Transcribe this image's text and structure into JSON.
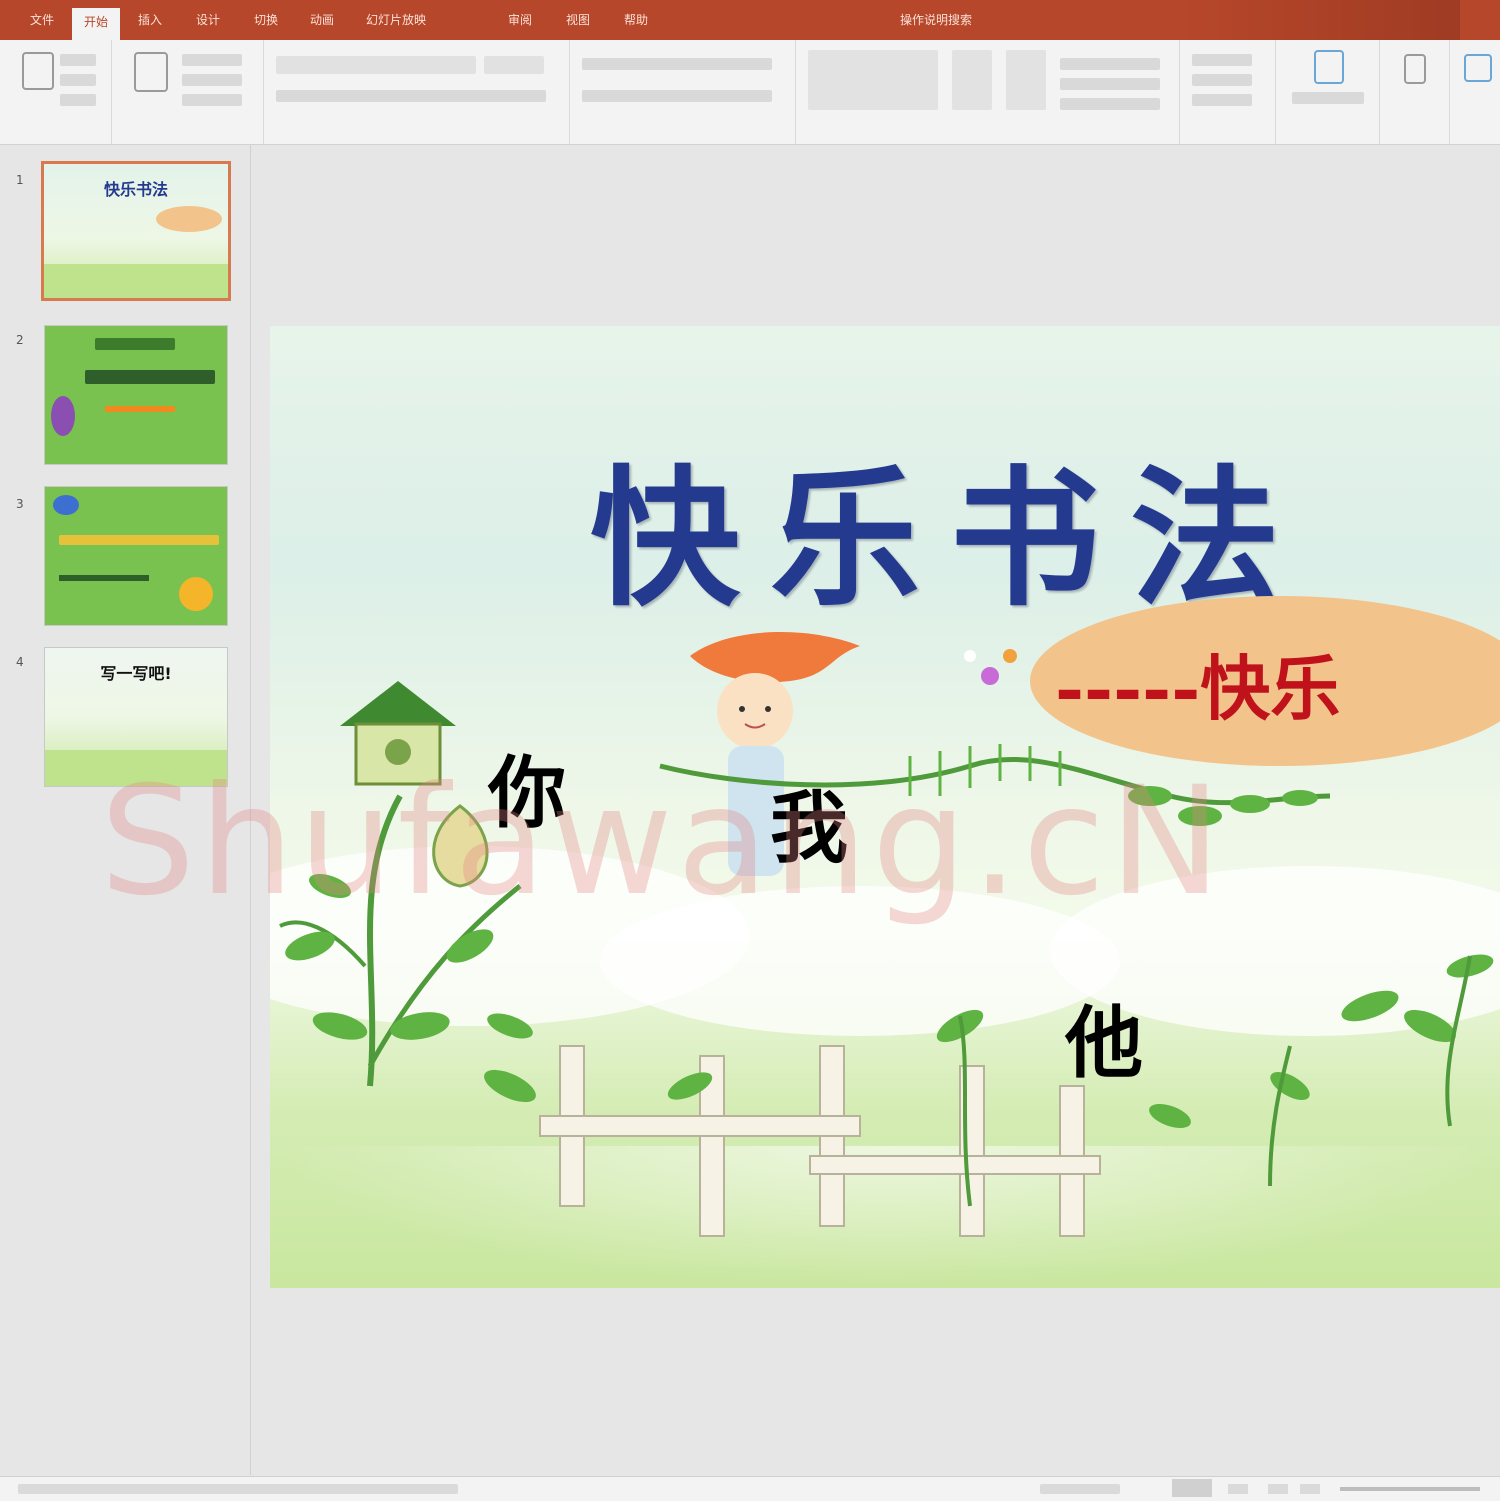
{
  "ribbon": {
    "tabs": [
      "文件",
      "开始",
      "插入",
      "设计",
      "切换",
      "动画",
      "幻灯片放映",
      "审阅",
      "视图",
      "帮助",
      "操作说明搜索"
    ],
    "active_tab_index": 1
  },
  "slides": [
    {
      "number": "1",
      "title": "快乐书法"
    },
    {
      "number": "2",
      "title": ""
    },
    {
      "number": "3",
      "title": ""
    },
    {
      "number": "4",
      "title": "写一写吧!"
    }
  ],
  "current_slide": {
    "title": "快乐书法",
    "subtitle": "-----快乐",
    "words": [
      "你",
      "我",
      "他"
    ]
  },
  "watermark": "Shufawang.cN",
  "colors": {
    "tab_bar": "#b7472a",
    "slide_title": "#243a8f",
    "subtitle": "#c0121b",
    "oval": "#f2c38b",
    "thumb_green": "#7ac24f"
  }
}
